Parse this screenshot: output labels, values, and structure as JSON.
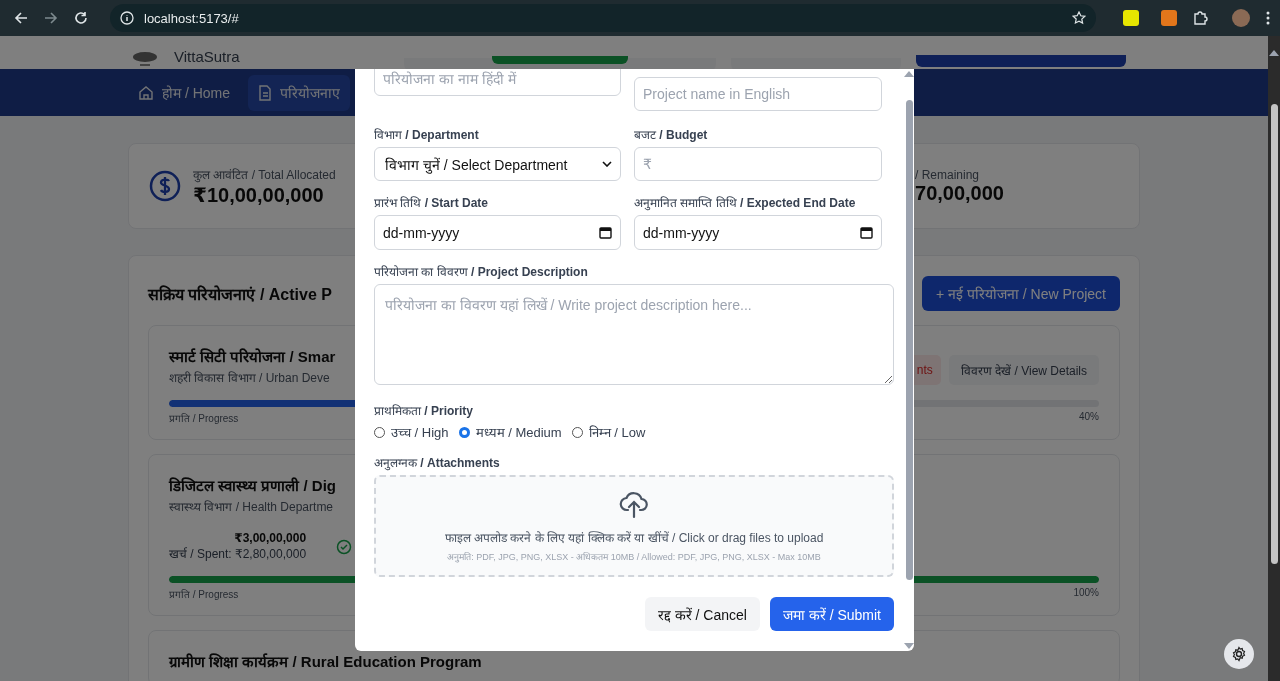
{
  "browser": {
    "url": "localhost:5173/#"
  },
  "header": {
    "brand": "VittaSutra"
  },
  "nav": {
    "items": [
      {
        "label": "होम / Home",
        "selected": false
      },
      {
        "label": "परियोजनाए",
        "selected": true
      }
    ]
  },
  "stats": [
    {
      "label": "कुल आवंटित / Total Allocated",
      "value": "₹10,00,00,000"
    },
    {
      "label": "/ Remaining",
      "value": "70,00,000"
    }
  ],
  "projects": {
    "title": "सक्रिय परियोजनाएं / Active P",
    "new_button": "+ नई परियोजना / New Project",
    "cards": [
      {
        "title": "स्मार्ट सिटी परियोजना / Smar",
        "department": "शहरी विकास विभाग / Urban Deve",
        "alert_button": "nts",
        "details_button": "विवरण देखें / View Details",
        "progress_label": "प्रगति / Progress",
        "level": 0.4,
        "percent": "40%",
        "complete": false
      },
      {
        "title": "डिजिटल स्वास्थ्य प्रणाली / Dig",
        "department": "स्वास्थ्य विभाग / Health Departme",
        "budget": "₹3,00,00,000",
        "spent": "खर्च / Spent: ₹2,80,00,000",
        "progress_label": "प्रगति / Progress",
        "level": 1,
        "percent": "100%",
        "complete": true
      },
      {
        "title": "ग्रामीण शिक्षा कार्यक्रम / Rural Education Program"
      }
    ]
  },
  "modal": {
    "name_hindi": {
      "placeholder": "परियोजना का नाम हिंदी में"
    },
    "name_english": {
      "placeholder": "Project name in English"
    },
    "department": {
      "label_hi": "विभाग",
      "label_en": "/ Department",
      "value": "विभाग चुनें / Select Department"
    },
    "budget": {
      "label_hi": "बजट",
      "label_en": "/ Budget",
      "placeholder": "₹"
    },
    "start_date": {
      "label_hi": "प्रारंभ तिथि",
      "label_en": "/ Start Date",
      "value": "dd-mm-yyyy"
    },
    "end_date": {
      "label_hi": "अनुमानित समाप्ति तिथि",
      "label_en": "/ Expected End Date",
      "value": "dd-mm-yyyy"
    },
    "description": {
      "label_hi": "परियोजना का विवरण",
      "label_en": "/ Project Description",
      "placeholder": "परियोजना का विवरण यहां लिखें / Write project description here..."
    },
    "priority": {
      "label_hi": "प्राथमिकता",
      "label_en": "/ Priority",
      "options": [
        {
          "label": "उच्च / High",
          "selected": false
        },
        {
          "label": "मध्यम / Medium",
          "selected": true
        },
        {
          "label": "निम्न / Low",
          "selected": false
        }
      ]
    },
    "attachments": {
      "label_hi": "अनुलग्नक",
      "label_en": "/ Attachments",
      "prompt": "फाइल अपलोड करने के लिए यहां क्लिक करें या खींचें / Click or drag files to upload",
      "hint": "अनुमति: PDF, JPG, PNG, XLSX - अधिकतम 10MB / Allowed: PDF, JPG, PNG, XLSX - Max 10MB"
    },
    "cancel": "रद्द करें / Cancel",
    "submit": "जमा करें / Submit"
  }
}
